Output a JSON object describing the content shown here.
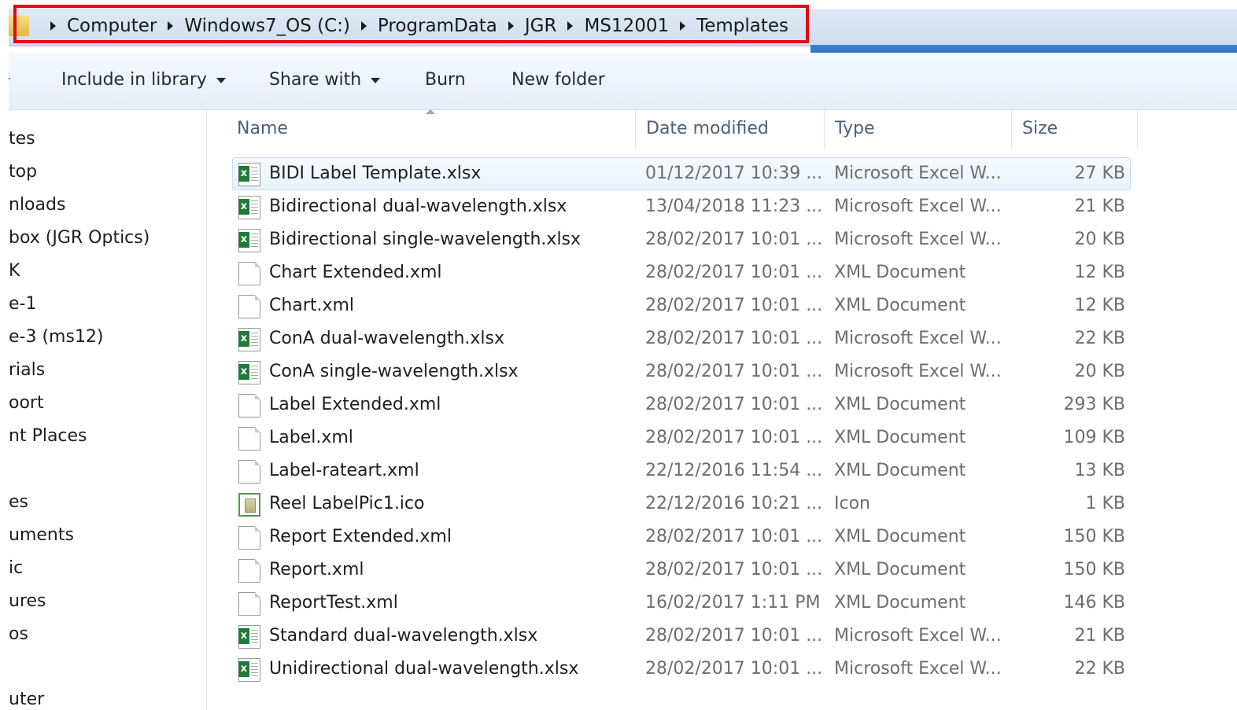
{
  "address_bar": {
    "crumbs": [
      "Computer",
      "Windows7_OS (C:)",
      "ProgramData",
      "JGR",
      "MS12001",
      "Templates"
    ]
  },
  "toolbar": {
    "include_in_library": "Include in library",
    "share_with": "Share with",
    "burn": "Burn",
    "new_folder": "New folder"
  },
  "nav_pane": {
    "items": [
      "tes",
      "top",
      "nloads",
      "box (JGR Optics)",
      "K",
      "e-1",
      "e-3 (ms12)",
      "rials",
      "oort",
      "nt Places",
      "es",
      "uments",
      "ic",
      "ures",
      "os",
      "uter"
    ]
  },
  "columns": {
    "name": "Name",
    "date": "Date modified",
    "type": "Type",
    "size": "Size"
  },
  "files": [
    {
      "name": "BIDI Label Template.xlsx",
      "date": "01/12/2017 10:39 ...",
      "type": "Microsoft Excel W...",
      "size": "27 KB",
      "icon": "excel-file-icon"
    },
    {
      "name": "Bidirectional dual-wavelength.xlsx",
      "date": "13/04/2018 11:23 ...",
      "type": "Microsoft Excel W...",
      "size": "21 KB",
      "icon": "excel-file-icon"
    },
    {
      "name": "Bidirectional single-wavelength.xlsx",
      "date": "28/02/2017 10:01 ...",
      "type": "Microsoft Excel W...",
      "size": "20 KB",
      "icon": "excel-file-icon"
    },
    {
      "name": "Chart Extended.xml",
      "date": "28/02/2017 10:01 ...",
      "type": "XML Document",
      "size": "12 KB",
      "icon": "xml-file-icon"
    },
    {
      "name": "Chart.xml",
      "date": "28/02/2017 10:01 ...",
      "type": "XML Document",
      "size": "12 KB",
      "icon": "xml-file-icon"
    },
    {
      "name": "ConA dual-wavelength.xlsx",
      "date": "28/02/2017 10:01 ...",
      "type": "Microsoft Excel W...",
      "size": "22 KB",
      "icon": "excel-file-icon"
    },
    {
      "name": "ConA single-wavelength.xlsx",
      "date": "28/02/2017 10:01 ...",
      "type": "Microsoft Excel W...",
      "size": "20 KB",
      "icon": "excel-file-icon"
    },
    {
      "name": "Label Extended.xml",
      "date": "28/02/2017 10:01 ...",
      "type": "XML Document",
      "size": "293 KB",
      "icon": "xml-file-icon"
    },
    {
      "name": "Label.xml",
      "date": "28/02/2017 10:01 ...",
      "type": "XML Document",
      "size": "109 KB",
      "icon": "xml-file-icon"
    },
    {
      "name": "Label-rateart.xml",
      "date": "22/12/2016 11:54 ...",
      "type": "XML Document",
      "size": "13 KB",
      "icon": "xml-file-icon"
    },
    {
      "name": "Reel LabelPic1.ico",
      "date": "22/12/2016 10:21 ...",
      "type": "Icon",
      "size": "1 KB",
      "icon": "ico-file-icon"
    },
    {
      "name": "Report Extended.xml",
      "date": "28/02/2017 10:01 ...",
      "type": "XML Document",
      "size": "150 KB",
      "icon": "xml-file-icon"
    },
    {
      "name": "Report.xml",
      "date": "28/02/2017 10:01 ...",
      "type": "XML Document",
      "size": "150 KB",
      "icon": "xml-file-icon"
    },
    {
      "name": "ReportTest.xml",
      "date": "16/02/2017 1:11 PM",
      "type": "XML Document",
      "size": "146 KB",
      "icon": "xml-file-icon"
    },
    {
      "name": "Standard dual-wavelength.xlsx",
      "date": "28/02/2017 10:01 ...",
      "type": "Microsoft Excel W...",
      "size": "21 KB",
      "icon": "excel-file-icon"
    },
    {
      "name": "Unidirectional dual-wavelength.xlsx",
      "date": "28/02/2017 10:01 ...",
      "type": "Microsoft Excel W...",
      "size": "22 KB",
      "icon": "excel-file-icon"
    }
  ],
  "colors": {
    "highlight": "#e30613",
    "selection": "#e9f2fc"
  }
}
